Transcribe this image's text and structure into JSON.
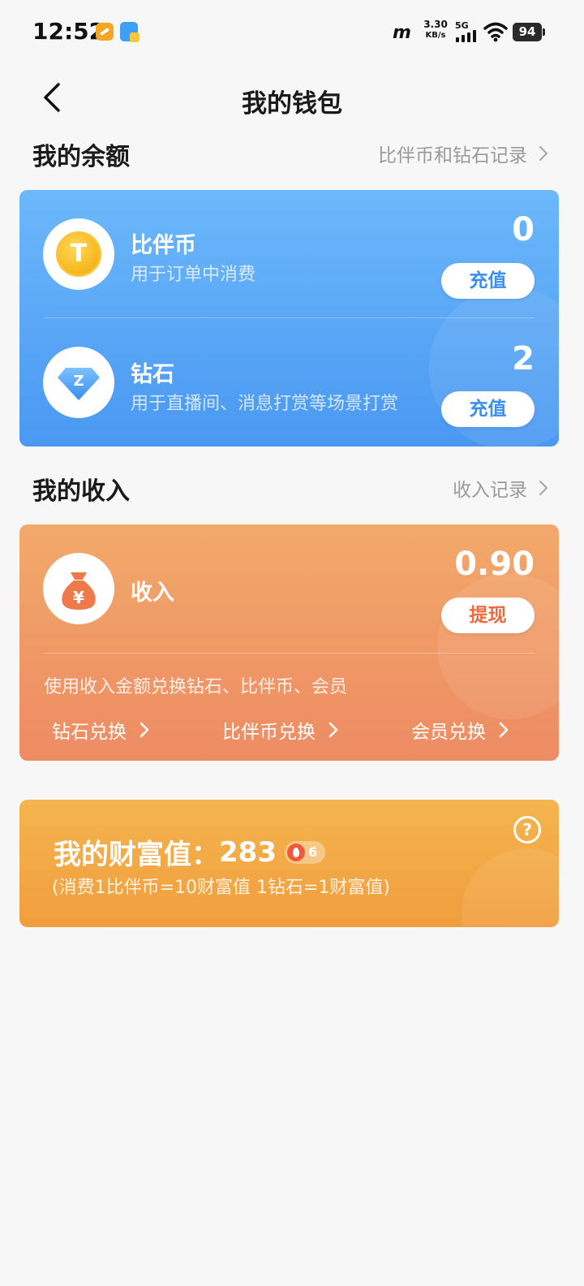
{
  "status": {
    "time": "12:52",
    "net_logo": "m",
    "net_speed_value": "3.30",
    "net_speed_unit": "KB/s",
    "signal_type": "5G",
    "battery": "94"
  },
  "header": {
    "title": "我的钱包"
  },
  "balance": {
    "section_title": "我的余额",
    "record_link": "比伴币和钻石记录",
    "items": [
      {
        "icon": "coin-icon",
        "title": "比伴币",
        "subtitle": "用于订单中消费",
        "amount": "0",
        "button": "充值"
      },
      {
        "icon": "diamond-icon",
        "title": "钻石",
        "subtitle": "用于直播间、消息打赏等场景打赏",
        "amount": "2",
        "button": "充值"
      }
    ]
  },
  "income": {
    "section_title": "我的收入",
    "record_link": "收入记录",
    "icon": "money-bag-icon",
    "title": "收入",
    "amount": "0.90",
    "button": "提现",
    "description": "使用收入金额兑换钻石、比伴币、会员",
    "exchanges": [
      "钻石兑换",
      "比伴币兑换",
      "会员兑换"
    ]
  },
  "wealth": {
    "label": "我的财富值：",
    "value": "283",
    "badge_level": "6",
    "note": "(消费1比伴币=10财富值 1钻石=1财富值)",
    "help_symbol": "?"
  },
  "colors": {
    "balance_card": "#4a98f2",
    "income_card": "#ee8b63",
    "wealth_card": "#f19d3e"
  }
}
